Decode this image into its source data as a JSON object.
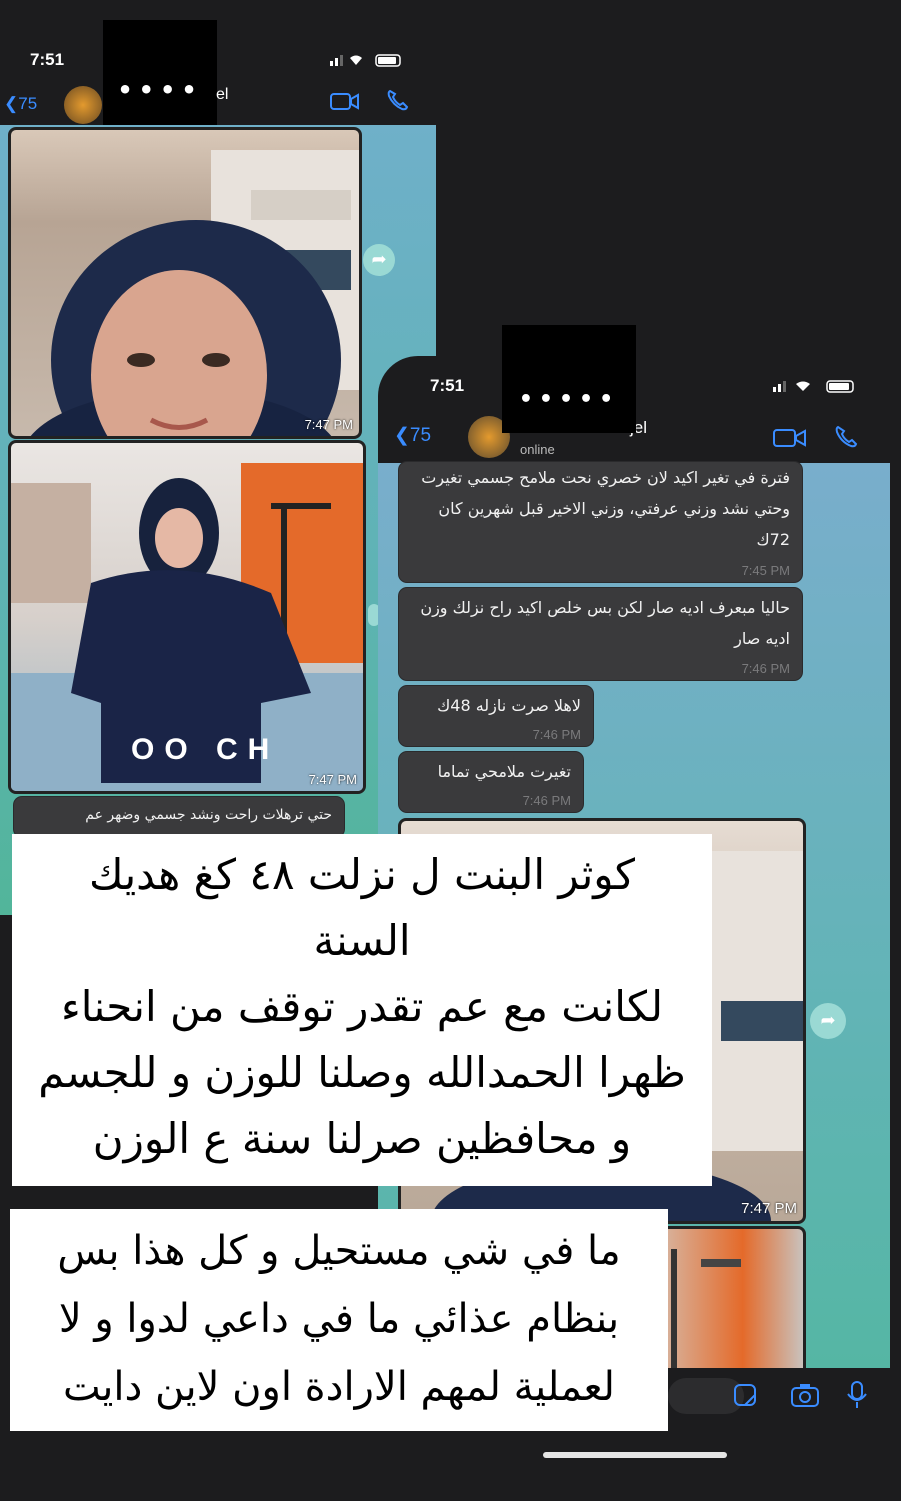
{
  "phone1": {
    "time": "7:51",
    "back_count": "75",
    "contact_partial": "el",
    "redacted_name": "••••",
    "photo1_time": "7:47 PM",
    "photo2_time": "7:47 PM",
    "hoodie_text": "OO CH",
    "partial_msg": "حتي ترهلات راحت ونشد جسمي وضهر عم"
  },
  "phone2": {
    "time": "7:51",
    "back_count": "75",
    "contact_partial": "jel",
    "status": "online",
    "redacted_name": "•••••",
    "messages": [
      {
        "text": "فترة في تغير اكيد لان خصري نحت ملامح جسمي تغيرت وحتي نشد وزني عرفتي، وزني الاخير قبل شهرين كان 72ك",
        "time": "7:45 PM"
      },
      {
        "text": "حاليا مبعرف اديه صار لكن بس خلص اكيد راح نزلك وزن اديه صار",
        "time": "7:46 PM"
      },
      {
        "text": "لاهلا صرت نازله 48ك",
        "time": "7:46 PM"
      },
      {
        "text": "تغيرت ملامحي تماما",
        "time": "7:46 PM"
      }
    ],
    "photo_time": "7:47 PM"
  },
  "overlay1": {
    "lines": [
      "كوثر البنت ل نزلت ٤٨ كغ هديك",
      "السنة",
      "لكانت مع عم تقدر توقف من انحناء",
      "ظهرا الحمدالله وصلنا للوزن و للجسم",
      "و محافظين صرلنا سنة ع الوزن"
    ]
  },
  "overlay2": {
    "lines": [
      "ما في شي مستحيل و كل هذا بس",
      "بنظام عذائي ما في داعي لدوا و لا",
      "لعملية لمهم الارادة اون لاين دايت"
    ]
  },
  "colors": {
    "ios_blue": "#3a8cff",
    "bubble": "#3a3a3c",
    "forward": "#9ad9d4"
  }
}
